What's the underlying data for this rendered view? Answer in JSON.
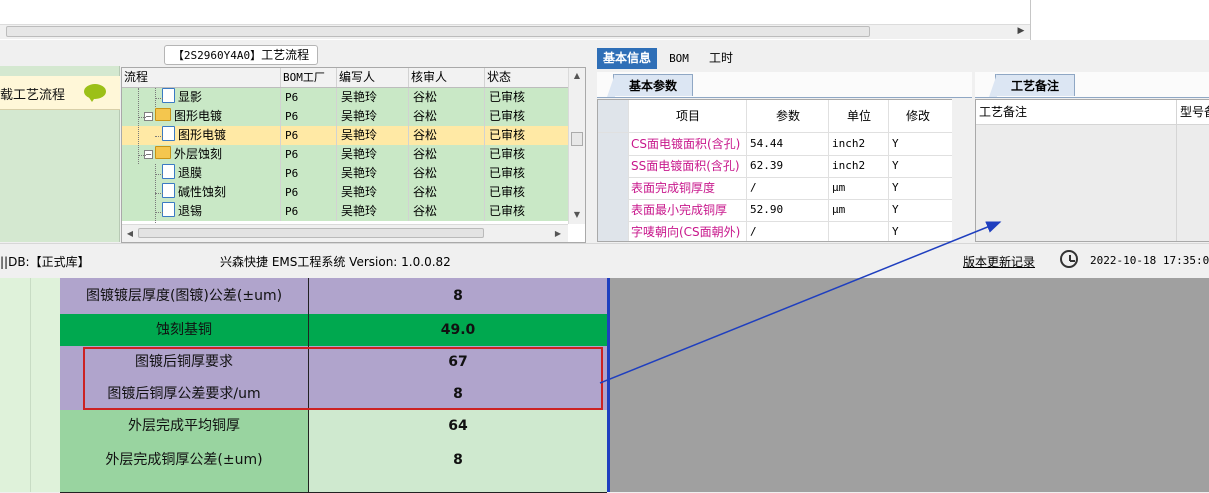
{
  "colors": {
    "accent": "#2f6fb7",
    "tree_row": "#c9e8c6",
    "tree_selected": "#ffe9a5",
    "param_name": "#c8188c",
    "sheet_purple": "#b0a4cc",
    "sheet_green": "#00a84f",
    "sheet_lightgreen": "#99d4a0",
    "annotation_red": "#cc2222",
    "annotation_blue": "#1f3fbf"
  },
  "left_panel": {
    "item_label": "载工艺流程",
    "icon": "speech-bubble-icon"
  },
  "process_group": {
    "code": "【2S2960Y4A0】",
    "title": "工艺流程"
  },
  "tree": {
    "columns": [
      "流程",
      "BOM工厂",
      "编写人",
      "核审人",
      "状态"
    ],
    "rows": [
      {
        "name": "显影",
        "level": 1,
        "type": "node",
        "bom": "P6",
        "writer": "吴艳玲",
        "reviewer": "谷松",
        "status": "已审核",
        "selected": false
      },
      {
        "name": "图形电镀",
        "level": 0,
        "type": "folder",
        "bom": "P6",
        "writer": "吴艳玲",
        "reviewer": "谷松",
        "status": "已审核",
        "selected": false
      },
      {
        "name": "图形电镀",
        "level": 1,
        "type": "node",
        "bom": "P6",
        "writer": "吴艳玲",
        "reviewer": "谷松",
        "status": "已审核",
        "selected": true
      },
      {
        "name": "外层蚀刻",
        "level": 0,
        "type": "folder",
        "bom": "P6",
        "writer": "吴艳玲",
        "reviewer": "谷松",
        "status": "已审核",
        "selected": false
      },
      {
        "name": "退膜",
        "level": 1,
        "type": "node",
        "bom": "P6",
        "writer": "吴艳玲",
        "reviewer": "谷松",
        "status": "已审核",
        "selected": false
      },
      {
        "name": "碱性蚀刻",
        "level": 1,
        "type": "node",
        "bom": "P6",
        "writer": "吴艳玲",
        "reviewer": "谷松",
        "status": "已审核",
        "selected": false
      },
      {
        "name": "退锡",
        "level": 1,
        "type": "node",
        "bom": "P6",
        "writer": "吴艳玲",
        "reviewer": "谷松",
        "status": "已审核",
        "selected": false
      }
    ]
  },
  "tabs": [
    "基本信息",
    "BOM",
    "工时"
  ],
  "params_tab": "基本参数",
  "params": {
    "columns": [
      "项目",
      "参数",
      "单位",
      "修改"
    ],
    "rows": [
      {
        "name": "CS面电镀面积(含孔)",
        "value": "54.44",
        "unit": "inch2",
        "mod": "Y"
      },
      {
        "name": "SS面电镀面积(含孔)",
        "value": "62.39",
        "unit": "inch2",
        "mod": "Y"
      },
      {
        "name": "表面完成铜厚度",
        "value": "/",
        "unit": "μm",
        "mod": "Y"
      },
      {
        "name": "表面最小完成铜厚",
        "value": "52.90",
        "unit": "μm",
        "mod": "Y"
      },
      {
        "name": "字唛朝向(CS面朝外)",
        "value": "/",
        "unit": "",
        "mod": "Y"
      }
    ]
  },
  "remark": {
    "tab": "工艺备注",
    "columns": [
      "工艺备注",
      "型号备"
    ]
  },
  "status_bar": {
    "db": "||DB:【正式库】",
    "system": "兴森快捷 EMS工程系统 Version: 1.0.0.82",
    "update_link": "版本更新记录",
    "datetime": "2022-10-18 17:35:08"
  },
  "sheet": {
    "rows": [
      {
        "label": "图镀镀层厚度(图镀)公差(±um)",
        "value": "8"
      },
      {
        "label": "蚀刻基铜",
        "value": "49.0"
      },
      {
        "label": "图镀后铜厚要求",
        "value": "67"
      },
      {
        "label": "图镀后铜厚公差要求/um",
        "value": "8"
      },
      {
        "label": "外层完成平均铜厚",
        "value": "64"
      },
      {
        "label": "外层完成铜厚公差(±um)",
        "value": "8"
      },
      {
        "label": "",
        "value": ""
      }
    ]
  }
}
